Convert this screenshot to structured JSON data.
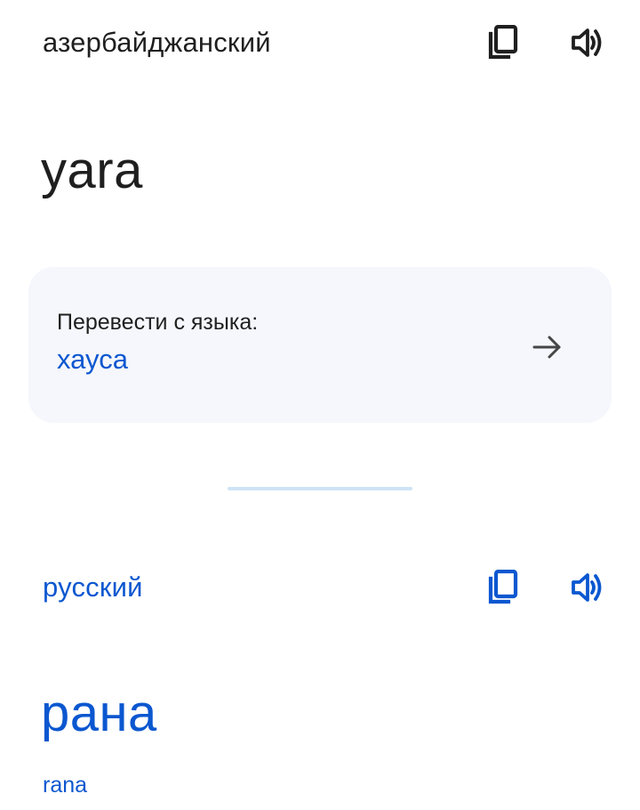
{
  "source": {
    "language": "азербайджанский",
    "text": "yara",
    "copy_icon": "copy-icon",
    "speak_icon": "speaker-icon"
  },
  "detect_card": {
    "label": "Перевести с языка:",
    "language": "хауса",
    "arrow_icon": "arrow-right-icon"
  },
  "target": {
    "language": "русский",
    "text": "рана",
    "transliteration": "rana",
    "copy_icon": "copy-icon",
    "speak_icon": "speaker-icon"
  },
  "colors": {
    "accent": "#0b57d0",
    "text": "#1f1f1f",
    "card_bg": "#f5f7fc",
    "divider": "#cfe3f6"
  }
}
